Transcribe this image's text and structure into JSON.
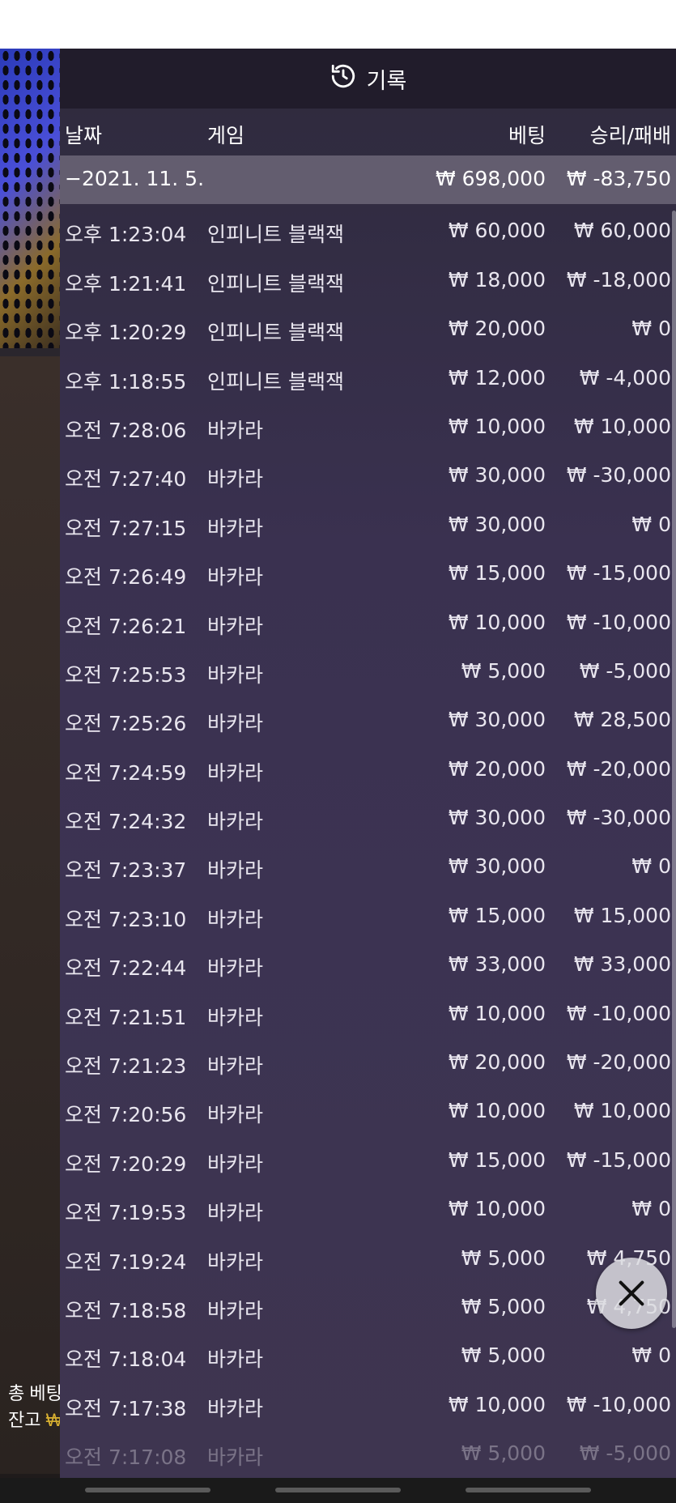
{
  "header": {
    "title": "기록",
    "icon": "history-icon"
  },
  "columns": {
    "date": "날짜",
    "game": "게임",
    "bet": "베팅",
    "result": "승리/패배"
  },
  "date_group": {
    "date": "−2021. 11. 5.",
    "bet": "₩ 698,000",
    "result": "₩ -83,750"
  },
  "rows": [
    {
      "time": "오후 1:23:04",
      "game": "인피니트 블랙잭",
      "bet": "₩ 60,000",
      "result": "₩ 60,000"
    },
    {
      "time": "오후 1:21:41",
      "game": "인피니트 블랙잭",
      "bet": "₩ 18,000",
      "result": "₩ -18,000"
    },
    {
      "time": "오후 1:20:29",
      "game": "인피니트 블랙잭",
      "bet": "₩ 20,000",
      "result": "₩ 0"
    },
    {
      "time": "오후 1:18:55",
      "game": "인피니트 블랙잭",
      "bet": "₩ 12,000",
      "result": "₩ -4,000"
    },
    {
      "time": "오전 7:28:06",
      "game": "바카라",
      "bet": "₩ 10,000",
      "result": "₩ 10,000"
    },
    {
      "time": "오전 7:27:40",
      "game": "바카라",
      "bet": "₩ 30,000",
      "result": "₩ -30,000"
    },
    {
      "time": "오전 7:27:15",
      "game": "바카라",
      "bet": "₩ 30,000",
      "result": "₩ 0"
    },
    {
      "time": "오전 7:26:49",
      "game": "바카라",
      "bet": "₩ 15,000",
      "result": "₩ -15,000"
    },
    {
      "time": "오전 7:26:21",
      "game": "바카라",
      "bet": "₩ 10,000",
      "result": "₩ -10,000"
    },
    {
      "time": "오전 7:25:53",
      "game": "바카라",
      "bet": "₩ 5,000",
      "result": "₩ -5,000"
    },
    {
      "time": "오전 7:25:26",
      "game": "바카라",
      "bet": "₩ 30,000",
      "result": "₩ 28,500"
    },
    {
      "time": "오전 7:24:59",
      "game": "바카라",
      "bet": "₩ 20,000",
      "result": "₩ -20,000"
    },
    {
      "time": "오전 7:24:32",
      "game": "바카라",
      "bet": "₩ 30,000",
      "result": "₩ -30,000"
    },
    {
      "time": "오전 7:23:37",
      "game": "바카라",
      "bet": "₩ 30,000",
      "result": "₩ 0"
    },
    {
      "time": "오전 7:23:10",
      "game": "바카라",
      "bet": "₩ 15,000",
      "result": "₩ 15,000"
    },
    {
      "time": "오전 7:22:44",
      "game": "바카라",
      "bet": "₩ 33,000",
      "result": "₩ 33,000"
    },
    {
      "time": "오전 7:21:51",
      "game": "바카라",
      "bet": "₩ 10,000",
      "result": "₩ -10,000"
    },
    {
      "time": "오전 7:21:23",
      "game": "바카라",
      "bet": "₩ 20,000",
      "result": "₩ -20,000"
    },
    {
      "time": "오전 7:20:56",
      "game": "바카라",
      "bet": "₩ 10,000",
      "result": "₩ 10,000"
    },
    {
      "time": "오전 7:20:29",
      "game": "바카라",
      "bet": "₩ 15,000",
      "result": "₩ -15,000"
    },
    {
      "time": "오전 7:19:53",
      "game": "바카라",
      "bet": "₩ 10,000",
      "result": "₩ 0"
    },
    {
      "time": "오전 7:19:24",
      "game": "바카라",
      "bet": "₩ 5,000",
      "result": "₩ 4,750"
    },
    {
      "time": "오전 7:18:58",
      "game": "바카라",
      "bet": "₩ 5,000",
      "result": "₩ 4,750"
    },
    {
      "time": "오전 7:18:04",
      "game": "바카라",
      "bet": "₩ 5,000",
      "result": "₩ 0"
    },
    {
      "time": "오전 7:17:38",
      "game": "바카라",
      "bet": "₩ 10,000",
      "result": "₩ -10,000"
    },
    {
      "time": "오전 7:17:08",
      "game": "바카라",
      "bet": "₩ 5,000",
      "result": "₩ -5,000"
    }
  ],
  "background_overlay": {
    "total_bet_label": "총 베팅",
    "balance_label": "잔고",
    "currency_symbol": "₩"
  },
  "close_button": {
    "icon": "close-icon"
  },
  "colors": {
    "panel": "#3a3150",
    "date_row": "#8c8796",
    "gold": "#d8b030"
  }
}
